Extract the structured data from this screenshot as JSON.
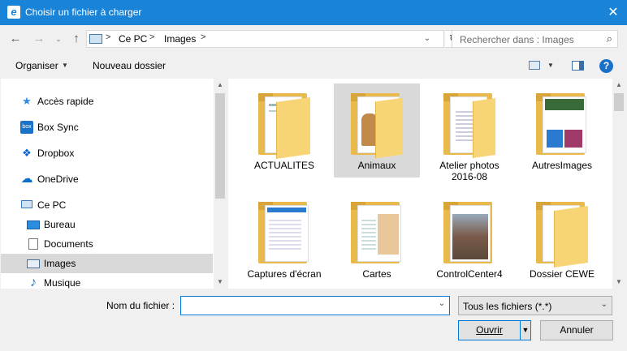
{
  "window": {
    "title": "Choisir un fichier à charger",
    "close_glyph": "✕",
    "icon": "ie-icon"
  },
  "nav": {
    "back_glyph": "←",
    "forward_glyph": "→",
    "recent_glyph": "⌄",
    "up_glyph": "↑"
  },
  "address": {
    "segments": [
      "Ce PC",
      "Images"
    ],
    "separator": ">",
    "dropdown_glyph": "⌄",
    "refresh_glyph": "↻"
  },
  "search": {
    "placeholder": "Rechercher dans : Images",
    "icon_glyph": "⌕"
  },
  "toolbar": {
    "organize_label": "Organiser",
    "organize_caret": "▼",
    "new_folder_label": "Nouveau dossier",
    "view_caret": "▼",
    "help_glyph": "?"
  },
  "sidebar": {
    "items": [
      {
        "label": "Accès rapide",
        "icon": "star-icon",
        "glyph": "★",
        "color": "#2e8ce0"
      },
      {
        "label": "Box Sync",
        "icon": "box-icon",
        "glyph": "box",
        "color": "#1a73c9"
      },
      {
        "label": "Dropbox",
        "icon": "dropbox-icon",
        "glyph": "❖",
        "color": "#0d61d5"
      },
      {
        "label": "OneDrive",
        "icon": "cloud-icon",
        "glyph": "☁",
        "color": "#0d6ec9"
      },
      {
        "label": "Ce PC",
        "icon": "computer-icon",
        "glyph": "▭",
        "color": "#3a7ab8"
      },
      {
        "label": "Bureau",
        "icon": "desktop-icon",
        "glyph": "▬",
        "color": "#2a8de0"
      },
      {
        "label": "Documents",
        "icon": "document-icon",
        "glyph": "▤",
        "color": "#666666"
      },
      {
        "label": "Images",
        "icon": "pictures-icon",
        "glyph": "▣",
        "color": "#4a6e94"
      },
      {
        "label": "Musique",
        "icon": "music-icon",
        "glyph": "♪",
        "color": "#1a73c9"
      }
    ],
    "selected": "Images",
    "scroll_up": "▲",
    "scroll_down": "▼"
  },
  "files": {
    "items": [
      {
        "label": "ACTUALITES",
        "thumb": "page"
      },
      {
        "label": "Animaux",
        "thumb": "dogs"
      },
      {
        "label": "Atelier photos\n2016-08",
        "thumb": "page"
      },
      {
        "label": "AutresImages",
        "thumb": "web"
      },
      {
        "label": "Captures d'écran",
        "thumb": "screen"
      },
      {
        "label": "Cartes",
        "thumb": "map"
      },
      {
        "label": "ControlCenter4",
        "thumb": "house"
      },
      {
        "label": "Dossier CEWE",
        "thumb": "plain"
      }
    ],
    "selected": "Animaux",
    "scroll_up": "▲",
    "scroll_down": "▼"
  },
  "footer": {
    "filename_label": "Nom du fichier :",
    "filename_value": "",
    "filename_dropdown": "⌄",
    "filetype_value": "Tous les fichiers (*.*)",
    "filetype_caret": "⌄",
    "open_label": "Ouvrir",
    "open_split": "▼",
    "cancel_label": "Annuler"
  },
  "colors": {
    "titlebar": "#1883d7",
    "folder": "#e8b94b",
    "selection": "#d9d9d9",
    "focus_border": "#0078d7"
  }
}
